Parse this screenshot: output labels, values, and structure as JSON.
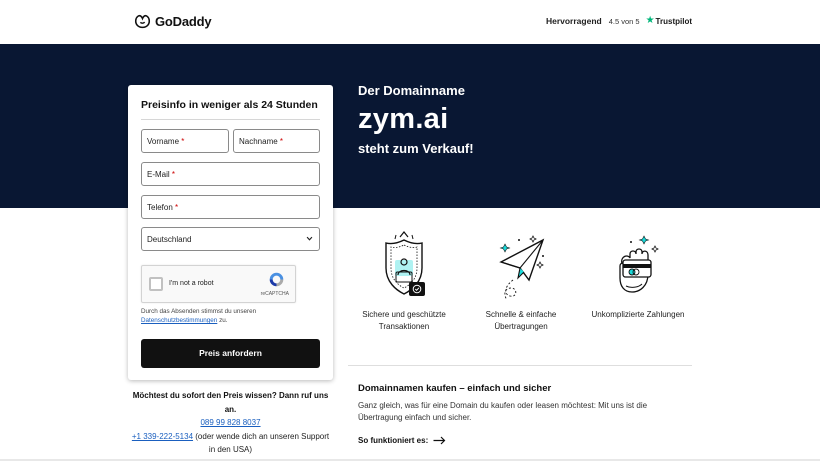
{
  "header": {
    "brand": "GoDaddy",
    "rating_word": "Hervorragend",
    "rating_score": "4.5 von 5",
    "trust_brand": "Trustpilot"
  },
  "hero": {
    "pre": "Der Domainname",
    "domain": "zym.ai",
    "post": "steht zum Verkauf!"
  },
  "form": {
    "title": "Preisinfo in weniger als 24 Stunden",
    "first_name_label": "Vorname",
    "last_name_label": "Nachname",
    "email_label": "E-Mail",
    "phone_label": "Telefon",
    "required_mark": "*",
    "country_value": "Deutschland",
    "captcha_text": "I'm not a robot",
    "captcha_brand": "reCAPTCHA",
    "consent_pre": "Durch das Absenden stimmst du unseren",
    "consent_link": "Datenschutzbestimmungen",
    "consent_post": "zu.",
    "submit_label": "Preis anfordern"
  },
  "contact": {
    "question": "Möchtest du sofort den Preis wissen? Dann ruf uns an.",
    "phone_de": "089 99 828 8037",
    "phone_us": "+1 339-222-5134",
    "us_note": "(oder wende dich an unseren Support in den USA)"
  },
  "features": [
    {
      "label": "Sichere und geschützte Transaktionen",
      "icon": "shield-lock-icon"
    },
    {
      "label": "Schnelle & einfache Übertragungen",
      "icon": "paper-plane-icon"
    },
    {
      "label": "Unkomplizierte Zahlungen",
      "icon": "hand-card-icon"
    }
  ],
  "info": {
    "title": "Domainnamen kaufen – einfach und sicher",
    "text": "Ganz gleich, was für eine Domain du kaufen oder leasen möchtest: Mit uns ist die Übertragung einfach und sicher.",
    "howto_label": "So funktioniert es:"
  },
  "colors": {
    "hero_bg": "#091733",
    "accent_teal": "#1bdbdb",
    "trustpilot_green": "#00b67a",
    "link_blue": "#1a5fbf",
    "button_bg": "#111111"
  }
}
